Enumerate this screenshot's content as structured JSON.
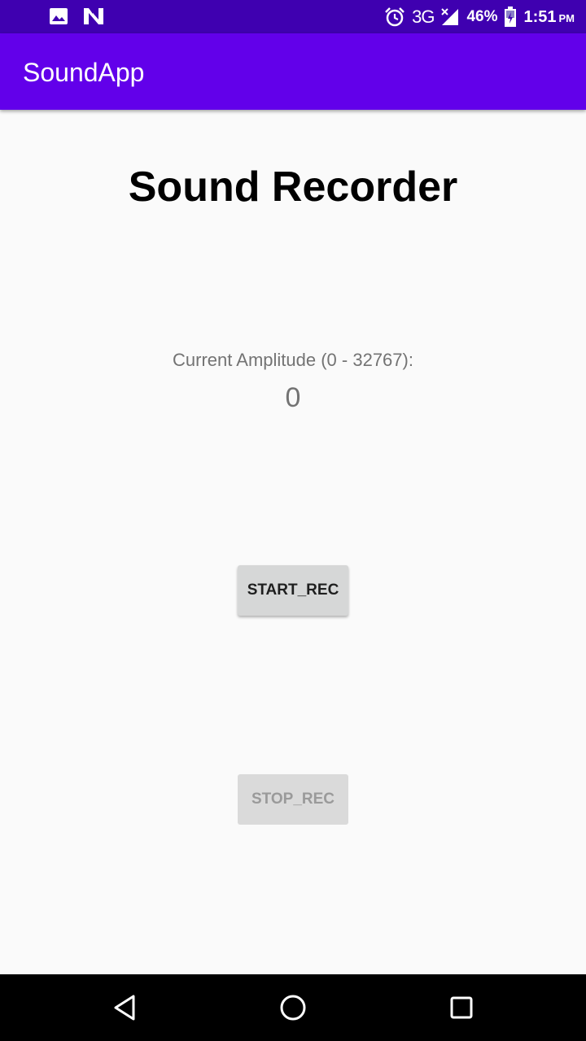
{
  "status_bar": {
    "left_icons": [
      "image-icon",
      "n-icon"
    ],
    "right_icons": [
      "alarm-icon",
      "signal-icon",
      "battery-icon"
    ],
    "network_type": "3G",
    "battery_percent": "46%",
    "time": "1:51",
    "ampm": "PM",
    "background": "#3f00b0"
  },
  "app_bar": {
    "title": "SoundApp",
    "background": "#6200ea"
  },
  "main": {
    "heading": "Sound Recorder",
    "amplitude_label": "Current Amplitude (0 - 32767):",
    "amplitude_value": "0",
    "start_button": {
      "label": "START_REC",
      "enabled": true
    },
    "stop_button": {
      "label": "STOP_REC",
      "enabled": false
    }
  },
  "nav_bar": {
    "buttons": [
      "back-icon",
      "home-icon",
      "recents-icon"
    ]
  }
}
